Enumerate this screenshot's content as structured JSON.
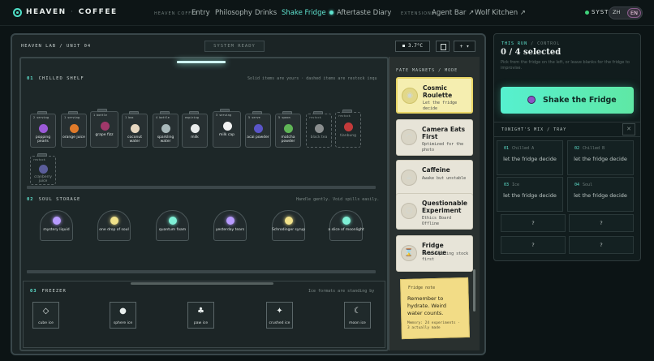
{
  "nav": {
    "brand": "HEAVEN",
    "brand2": "COFFEE",
    "small1": "HEAVEN COFFEE",
    "links": [
      "Entry",
      "Philosophy",
      "Drinks",
      "Shake Fridge",
      "Aftertaste Diary"
    ],
    "small2": "EXTENSIONS",
    "ext": [
      "Agent Bar ↗",
      "Wolf Kitchen ↗"
    ],
    "system": "SYSTE",
    "lang_zh": "ZH",
    "lang_en": "EN"
  },
  "lab": {
    "title": "HEAVEN LAB / UNIT 04",
    "status": "SYSTEM READY",
    "temp": "3.7°C",
    "plus": "+ ▾"
  },
  "chilled": {
    "num": "01",
    "title": "CHILLED SHELF",
    "hint": "Solid items are yours · dashed items are restock inqu",
    "items": [
      {
        "tag": "2 serving",
        "name": "popping pearls",
        "color": "#9b5ad8"
      },
      {
        "tag": "1 serving",
        "name": "orange juice",
        "color": "#e07a2a"
      },
      {
        "tag": "1 bottle",
        "name": "grape fizz",
        "color": "#a0386a"
      },
      {
        "tag": "1 box",
        "name": "coconut water",
        "color": "#e6d7c0"
      },
      {
        "tag": "4 bottle",
        "name": "sparkling water",
        "color": "#a8b8ba"
      },
      {
        "tag": "expiring",
        "name": "milk",
        "color": "#e9ecec"
      },
      {
        "tag": "3 serving",
        "name": "milk cap",
        "color": "#f2f2f2"
      },
      {
        "tag": "5 serve",
        "name": "acai powder",
        "color": "#5a55c8"
      },
      {
        "tag": "5 spoon",
        "name": "matcha powder",
        "color": "#5fb556"
      },
      {
        "tag": "restock",
        "name": "black tea",
        "color": "#8a8e8e"
      },
      {
        "tag": "restock",
        "name": "tianbung",
        "color": "#c23a3a"
      },
      {
        "tag": "restock",
        "name": "cranberry juice",
        "color": "#5a5d9a"
      }
    ]
  },
  "soul": {
    "num": "02",
    "title": "SOUL STORAGE",
    "hint": "Handle gently. Void spills easily.",
    "items": [
      {
        "name": "mystery liquid",
        "color": "#b89bff"
      },
      {
        "name": "one drop of soul",
        "color": "#f1e28a"
      },
      {
        "name": "quantum foam",
        "color": "#7ff0d6"
      },
      {
        "name": "yesterday tears",
        "color": "#b89bff"
      },
      {
        "name": "Schrodinger syrup",
        "color": "#f1e28a"
      },
      {
        "name": "a slice of moonlight",
        "color": "#7ff0d6"
      }
    ]
  },
  "freezer": {
    "num": "03",
    "title": "FREEZER",
    "hint": "Ice formats are standing by",
    "items": [
      {
        "icon": "◇",
        "name": "cube ice"
      },
      {
        "icon": "●",
        "name": "sphere ice"
      },
      {
        "icon": "♣",
        "name": "paw ice"
      },
      {
        "icon": "✦",
        "name": "crushed ice"
      },
      {
        "icon": "☾",
        "name": "moon ice"
      }
    ]
  },
  "magnets": {
    "title": "FATE MAGNETS / MODE",
    "items": [
      {
        "title": "Cosmic Roulette",
        "desc": "Let the fridge decide",
        "icon": "◉"
      },
      {
        "title": "Camera Eats First",
        "desc": "Optimized for the photo",
        "icon": "◠"
      },
      {
        "title": "Caffeine",
        "desc": "Awake but unstable",
        "icon": "☕"
      },
      {
        "title": "Questionable Experiment",
        "desc": "Ethics Board Offline",
        "icon": "○"
      },
      {
        "title": "Fridge Rescue",
        "desc": "Save expiring stock first",
        "icon": "⌛"
      }
    ],
    "note_title": "Fridge note",
    "note_body": "Remember to hydrate. Weird water counts.",
    "note_foot": "Memory: 24 experiments · 3 actually made"
  },
  "control": {
    "label_a": "THIS RUN",
    "label_b": "/ CONTROL",
    "selected": "0 / 4 selected",
    "hint": "Pick from the fridge on the left, or leave blanks for the fridge to improvise.",
    "shake": "Shake the Fridge",
    "tray_title": "TONIGHT'S MIX / TRAY",
    "tray_close": "✕",
    "cells": [
      {
        "n": "01",
        "k": "Chilled A",
        "v": "let the fridge decide"
      },
      {
        "n": "02",
        "k": "Chilled B",
        "v": "let the fridge decide"
      },
      {
        "n": "03",
        "k": "Ice",
        "v": "let the fridge decide"
      },
      {
        "n": "04",
        "k": "Soul",
        "v": "let the fridge decide"
      }
    ],
    "q": [
      "?",
      "?",
      "?",
      "?"
    ]
  }
}
